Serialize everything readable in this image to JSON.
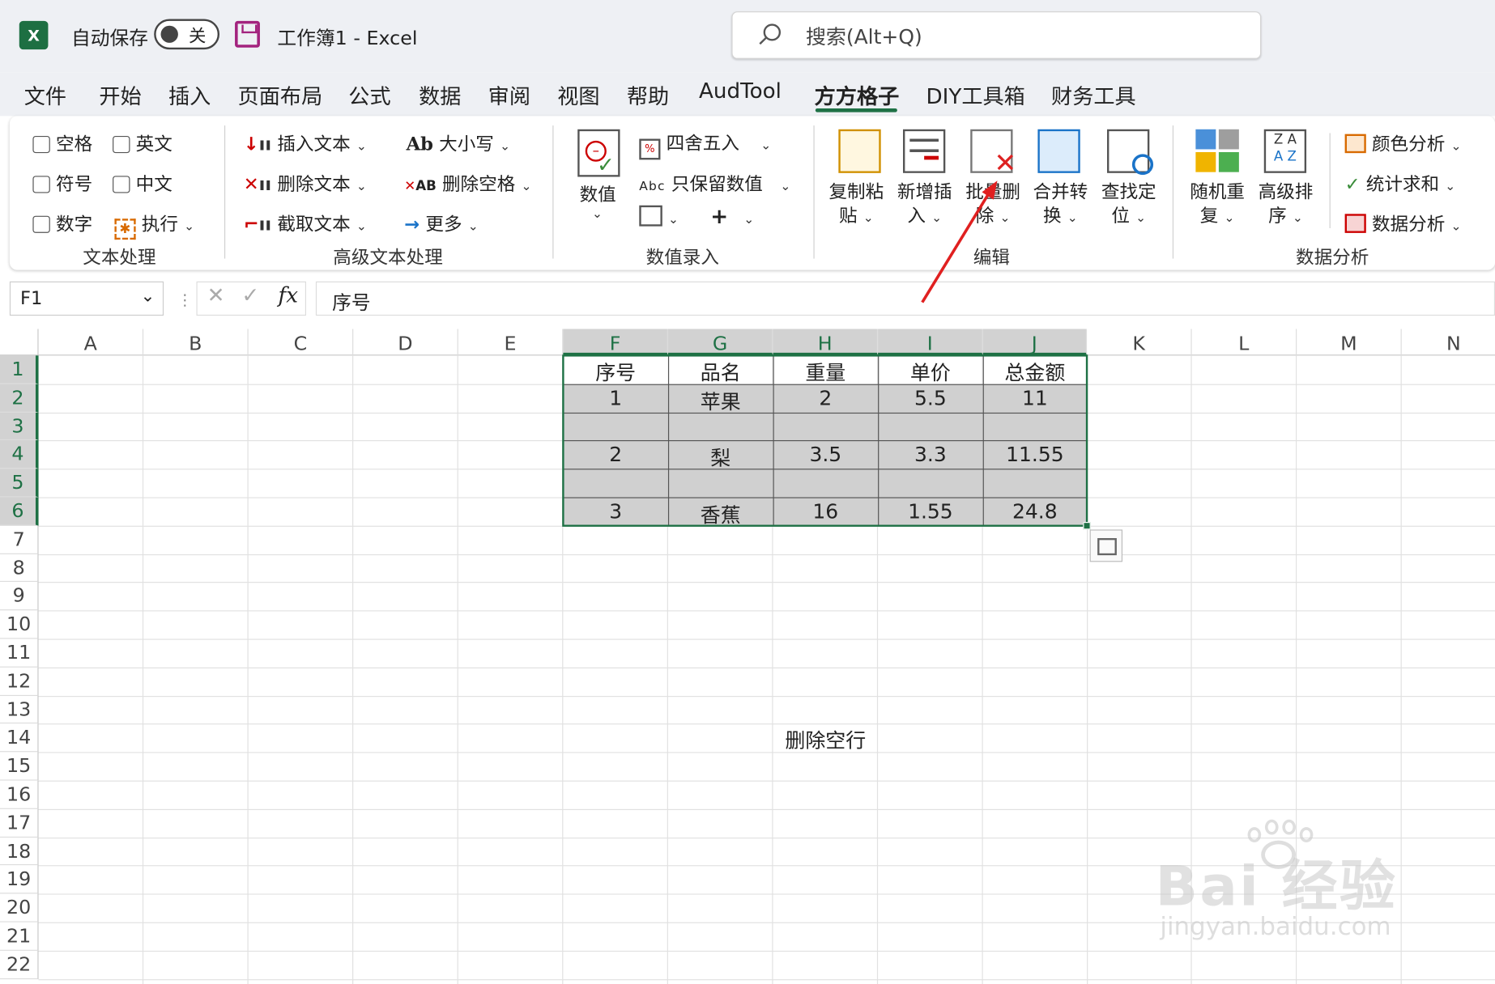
{
  "titlebar": {
    "app_icon": "X",
    "autosave_label": "自动保存",
    "autosave_state": "关",
    "document_title": "工作簿1  -  Excel",
    "search_placeholder": "搜索(Alt+Q)"
  },
  "menu_tabs": [
    "文件",
    "开始",
    "插入",
    "页面布局",
    "公式",
    "数据",
    "审阅",
    "视图",
    "帮助",
    "AudTool",
    "方方格子",
    "DIY工具箱",
    "财务工具"
  ],
  "active_tab": "方方格子",
  "ribbon": {
    "text_processing": {
      "checkboxes": [
        "空格",
        "英文",
        "符号",
        "中文",
        "数字"
      ],
      "execute": "执行",
      "group_label": "文本处理"
    },
    "advanced_text": {
      "insert_text": "插入文本",
      "delete_text": "删除文本",
      "extract_text": "截取文本",
      "case": "大小写",
      "delete_space": "删除空格",
      "more": "更多",
      "group_label": "高级文本处理",
      "ab_glyph": "Ab",
      "ab_small": "AB"
    },
    "data_entry": {
      "value": "数值",
      "round": "四舍五入",
      "keep_numeric": "只保留数值",
      "abc_glyph": "Abc",
      "plus_glyph": "+",
      "group_label": "数值录入"
    },
    "edit": {
      "copy_paste_line1": "复制粘",
      "copy_paste_line2": "贴",
      "insert_new_line1": "新增插",
      "insert_new_line2": "入",
      "batch_delete_line1": "批量删",
      "batch_delete_line2": "除",
      "merge_line1": "合并转",
      "merge_line2": "换",
      "find_line1": "查找定",
      "find_line2": "位",
      "group_label": "编辑"
    },
    "analysis": {
      "random_line1": "随机重",
      "random_line2": "复",
      "sort_line1": "高级排",
      "sort_line2": "序",
      "sort_glyph_left": "Z A",
      "sort_glyph_right": "A Z",
      "color_analysis": "颜色分析",
      "stat_sum": "统计求和",
      "data_analysis": "数据分析",
      "group_label": "数据分析"
    }
  },
  "formula_bar": {
    "name_box": "F1",
    "fx": "fx",
    "content": "序号"
  },
  "columns": [
    "A",
    "B",
    "C",
    "D",
    "E",
    "F",
    "G",
    "H",
    "I",
    "J",
    "K",
    "L",
    "M",
    "N"
  ],
  "rows": [
    "1",
    "2",
    "3",
    "4",
    "5",
    "6",
    "7",
    "8",
    "9",
    "10",
    "11",
    "12",
    "13",
    "14",
    "15",
    "16",
    "17",
    "18",
    "19",
    "20",
    "21",
    "22"
  ],
  "table": {
    "headers": [
      "序号",
      "品名",
      "重量",
      "单价",
      "总金额"
    ],
    "rows": [
      [
        "1",
        "苹果",
        "2",
        "5.5",
        "11"
      ],
      [
        "",
        "",
        "",
        "",
        ""
      ],
      [
        "2",
        "梨",
        "3.5",
        "3.3",
        "11.55"
      ],
      [
        "",
        "",
        "",
        "",
        ""
      ],
      [
        "3",
        "香蕉",
        "16",
        "1.55",
        "24.8"
      ]
    ]
  },
  "annotation": "删除空行",
  "watermark": {
    "logo": "Bai 经验",
    "url": "jingyan.baidu.com"
  }
}
